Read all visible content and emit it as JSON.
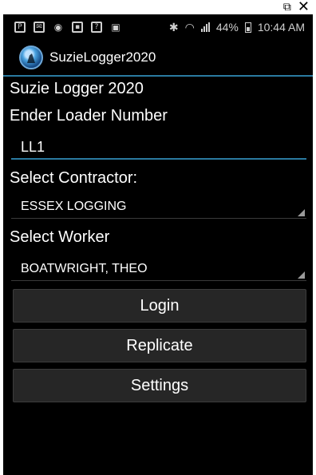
{
  "statusbar": {
    "battery_percent": "44%",
    "time": "10:44 AM"
  },
  "appbar": {
    "title": "SuzieLogger2020"
  },
  "main": {
    "heading": "Suzie Logger 2020",
    "ender_label": "Ender Loader Number",
    "ender_value": "LL1",
    "contractor_label": "Select Contractor:",
    "contractor_value": "ESSEX LOGGING",
    "worker_label": "Select Worker",
    "worker_value": "BOATWRIGHT, THEO"
  },
  "buttons": {
    "login": "Login",
    "replicate": "Replicate",
    "settings": "Settings"
  },
  "colors": {
    "accent": "#2a7aa0",
    "button_bg": "#262626",
    "background": "#000000"
  }
}
